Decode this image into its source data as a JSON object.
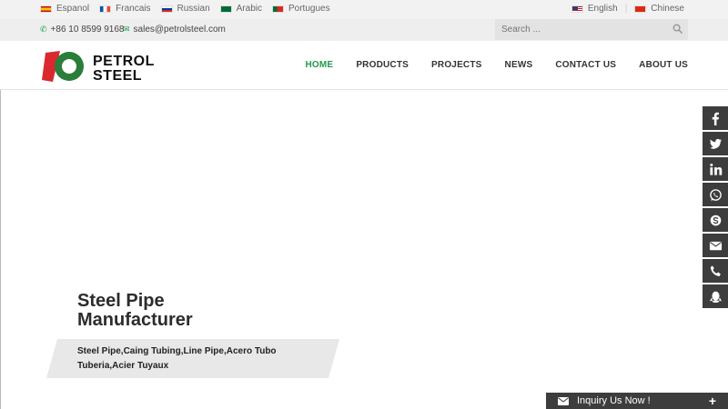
{
  "languages": [
    {
      "label": "Espanol",
      "flag": "es"
    },
    {
      "label": "Francais",
      "flag": "fr"
    },
    {
      "label": "Russian",
      "flag": "ru"
    },
    {
      "label": "Arabic",
      "flag": "sa"
    },
    {
      "label": "Portugues",
      "flag": "pt"
    }
  ],
  "site_languages": {
    "english": "English",
    "separator": "|",
    "chinese": "Chinese"
  },
  "contact": {
    "phone": "+86 10 8599 9168",
    "email": "sales@petrolsteel.com"
  },
  "search": {
    "placeholder": "Search ..."
  },
  "logo": {
    "line1": "PETROL",
    "line2": "STEEL"
  },
  "nav": [
    "HOME",
    "PRODUCTS",
    "PROJECTS",
    "NEWS",
    "CONTACT US",
    "ABOUT US"
  ],
  "hero": {
    "title": "Steel Pipe Manufacturer",
    "subtitle_line1": "Steel Pipe,Caing Tubing,Line Pipe,Acero Tubo",
    "subtitle_line2": "Tuberia,Acier Tuyaux"
  },
  "social": [
    "facebook-icon",
    "twitter-icon",
    "linkedin-icon",
    "whatsapp-icon",
    "skype-icon",
    "email-icon",
    "phone-icon",
    "qq-icon"
  ],
  "inquiry": {
    "label": "Inquiry Us Now !",
    "plus": "+"
  },
  "colors": {
    "accent": "#1f9b49",
    "logo_red": "#d9282f",
    "dark": "#3d3d3d"
  }
}
